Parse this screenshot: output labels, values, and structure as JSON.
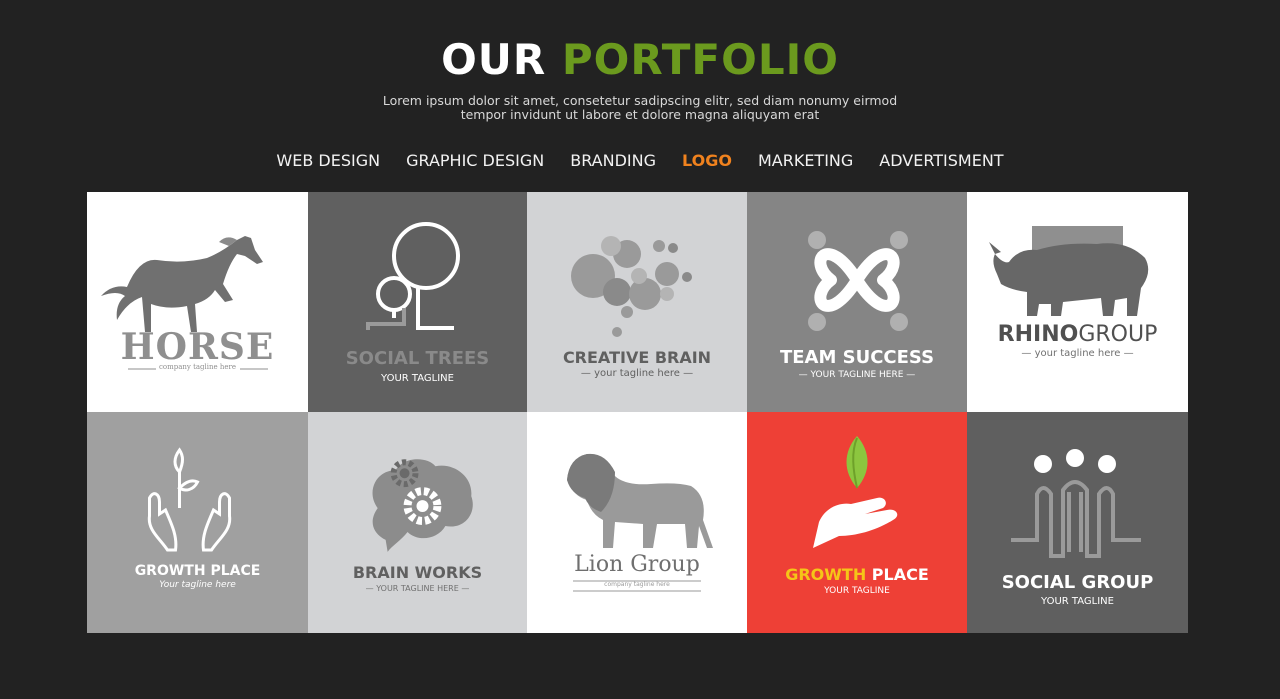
{
  "header": {
    "title_word1": "OUR",
    "title_word2": "PORTFOLIO",
    "subtitle_line1": "Lorem ipsum dolor sit amet, consetetur sadipscing elitr, sed diam nonumy eirmod",
    "subtitle_line2": "tempor invidunt ut labore et dolore magna aliquyam erat"
  },
  "nav": [
    {
      "label": "WEB DESIGN",
      "active": false
    },
    {
      "label": "GRAPHIC DESIGN",
      "active": false
    },
    {
      "label": "BRANDING",
      "active": false
    },
    {
      "label": "LOGO",
      "active": true
    },
    {
      "label": "MARKETING",
      "active": false
    },
    {
      "label": "ADVERTISMENT",
      "active": false
    }
  ],
  "tiles": [
    {
      "name": "HORSE",
      "tagline": "company tagline here",
      "icon": "horse-icon"
    },
    {
      "name": "SOCIAL TREES",
      "tagline": "YOUR TAGLINE",
      "icon": "tree-icon"
    },
    {
      "name": "CREATIVE BRAIN",
      "tagline": "— your tagline here —",
      "icon": "bubbles-brain-icon"
    },
    {
      "name": "TEAM SUCCESS",
      "tagline": "— YOUR TAGLINE HERE —",
      "icon": "knot-icon"
    },
    {
      "name_part1": "RHINO",
      "name_part2": "GROUP",
      "tagline": "— your tagline here —",
      "icon": "rhino-icon"
    },
    {
      "name": "GROWTH PLACE",
      "tagline": "Your tagline here",
      "icon": "hands-plant-icon"
    },
    {
      "name": "BRAIN WORKS",
      "tagline": "— YOUR TAGLINE HERE —",
      "icon": "brain-gears-icon"
    },
    {
      "name": "Lion Group",
      "tagline": "company tagline here",
      "icon": "lion-icon"
    },
    {
      "name_part1": "GROWTH",
      "name_part2": "PLACE",
      "tagline": "YOUR TAGLINE",
      "icon": "hand-leaf-icon"
    },
    {
      "name": "SOCIAL GROUP",
      "tagline": "YOUR TAGLINE",
      "icon": "people-group-icon"
    }
  ],
  "colors": {
    "background": "#222222",
    "accent_green": "#6b9a1e",
    "active_nav": "#f0821e",
    "highlight_tile": "#ee4036",
    "growth_yellow": "#f5c518"
  }
}
